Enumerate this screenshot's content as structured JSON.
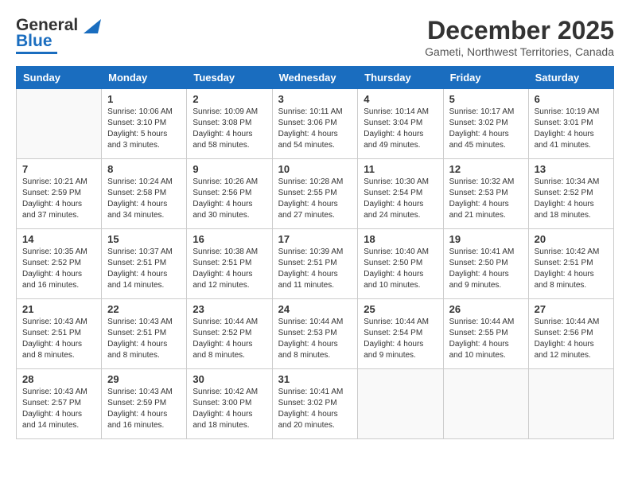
{
  "logo": {
    "line1": "General",
    "line2": "Blue"
  },
  "header": {
    "month": "December 2025",
    "location": "Gameti, Northwest Territories, Canada"
  },
  "weekdays": [
    "Sunday",
    "Monday",
    "Tuesday",
    "Wednesday",
    "Thursday",
    "Friday",
    "Saturday"
  ],
  "weeks": [
    [
      {
        "day": "",
        "text": ""
      },
      {
        "day": "1",
        "text": "Sunrise: 10:06 AM\nSunset: 3:10 PM\nDaylight: 5 hours\nand 3 minutes."
      },
      {
        "day": "2",
        "text": "Sunrise: 10:09 AM\nSunset: 3:08 PM\nDaylight: 4 hours\nand 58 minutes."
      },
      {
        "day": "3",
        "text": "Sunrise: 10:11 AM\nSunset: 3:06 PM\nDaylight: 4 hours\nand 54 minutes."
      },
      {
        "day": "4",
        "text": "Sunrise: 10:14 AM\nSunset: 3:04 PM\nDaylight: 4 hours\nand 49 minutes."
      },
      {
        "day": "5",
        "text": "Sunrise: 10:17 AM\nSunset: 3:02 PM\nDaylight: 4 hours\nand 45 minutes."
      },
      {
        "day": "6",
        "text": "Sunrise: 10:19 AM\nSunset: 3:01 PM\nDaylight: 4 hours\nand 41 minutes."
      }
    ],
    [
      {
        "day": "7",
        "text": "Sunrise: 10:21 AM\nSunset: 2:59 PM\nDaylight: 4 hours\nand 37 minutes."
      },
      {
        "day": "8",
        "text": "Sunrise: 10:24 AM\nSunset: 2:58 PM\nDaylight: 4 hours\nand 34 minutes."
      },
      {
        "day": "9",
        "text": "Sunrise: 10:26 AM\nSunset: 2:56 PM\nDaylight: 4 hours\nand 30 minutes."
      },
      {
        "day": "10",
        "text": "Sunrise: 10:28 AM\nSunset: 2:55 PM\nDaylight: 4 hours\nand 27 minutes."
      },
      {
        "day": "11",
        "text": "Sunrise: 10:30 AM\nSunset: 2:54 PM\nDaylight: 4 hours\nand 24 minutes."
      },
      {
        "day": "12",
        "text": "Sunrise: 10:32 AM\nSunset: 2:53 PM\nDaylight: 4 hours\nand 21 minutes."
      },
      {
        "day": "13",
        "text": "Sunrise: 10:34 AM\nSunset: 2:52 PM\nDaylight: 4 hours\nand 18 minutes."
      }
    ],
    [
      {
        "day": "14",
        "text": "Sunrise: 10:35 AM\nSunset: 2:52 PM\nDaylight: 4 hours\nand 16 minutes."
      },
      {
        "day": "15",
        "text": "Sunrise: 10:37 AM\nSunset: 2:51 PM\nDaylight: 4 hours\nand 14 minutes."
      },
      {
        "day": "16",
        "text": "Sunrise: 10:38 AM\nSunset: 2:51 PM\nDaylight: 4 hours\nand 12 minutes."
      },
      {
        "day": "17",
        "text": "Sunrise: 10:39 AM\nSunset: 2:51 PM\nDaylight: 4 hours\nand 11 minutes."
      },
      {
        "day": "18",
        "text": "Sunrise: 10:40 AM\nSunset: 2:50 PM\nDaylight: 4 hours\nand 10 minutes."
      },
      {
        "day": "19",
        "text": "Sunrise: 10:41 AM\nSunset: 2:50 PM\nDaylight: 4 hours\nand 9 minutes."
      },
      {
        "day": "20",
        "text": "Sunrise: 10:42 AM\nSunset: 2:51 PM\nDaylight: 4 hours\nand 8 minutes."
      }
    ],
    [
      {
        "day": "21",
        "text": "Sunrise: 10:43 AM\nSunset: 2:51 PM\nDaylight: 4 hours\nand 8 minutes."
      },
      {
        "day": "22",
        "text": "Sunrise: 10:43 AM\nSunset: 2:51 PM\nDaylight: 4 hours\nand 8 minutes."
      },
      {
        "day": "23",
        "text": "Sunrise: 10:44 AM\nSunset: 2:52 PM\nDaylight: 4 hours\nand 8 minutes."
      },
      {
        "day": "24",
        "text": "Sunrise: 10:44 AM\nSunset: 2:53 PM\nDaylight: 4 hours\nand 8 minutes."
      },
      {
        "day": "25",
        "text": "Sunrise: 10:44 AM\nSunset: 2:54 PM\nDaylight: 4 hours\nand 9 minutes."
      },
      {
        "day": "26",
        "text": "Sunrise: 10:44 AM\nSunset: 2:55 PM\nDaylight: 4 hours\nand 10 minutes."
      },
      {
        "day": "27",
        "text": "Sunrise: 10:44 AM\nSunset: 2:56 PM\nDaylight: 4 hours\nand 12 minutes."
      }
    ],
    [
      {
        "day": "28",
        "text": "Sunrise: 10:43 AM\nSunset: 2:57 PM\nDaylight: 4 hours\nand 14 minutes."
      },
      {
        "day": "29",
        "text": "Sunrise: 10:43 AM\nSunset: 2:59 PM\nDaylight: 4 hours\nand 16 minutes."
      },
      {
        "day": "30",
        "text": "Sunrise: 10:42 AM\nSunset: 3:00 PM\nDaylight: 4 hours\nand 18 minutes."
      },
      {
        "day": "31",
        "text": "Sunrise: 10:41 AM\nSunset: 3:02 PM\nDaylight: 4 hours\nand 20 minutes."
      },
      {
        "day": "",
        "text": ""
      },
      {
        "day": "",
        "text": ""
      },
      {
        "day": "",
        "text": ""
      }
    ]
  ]
}
